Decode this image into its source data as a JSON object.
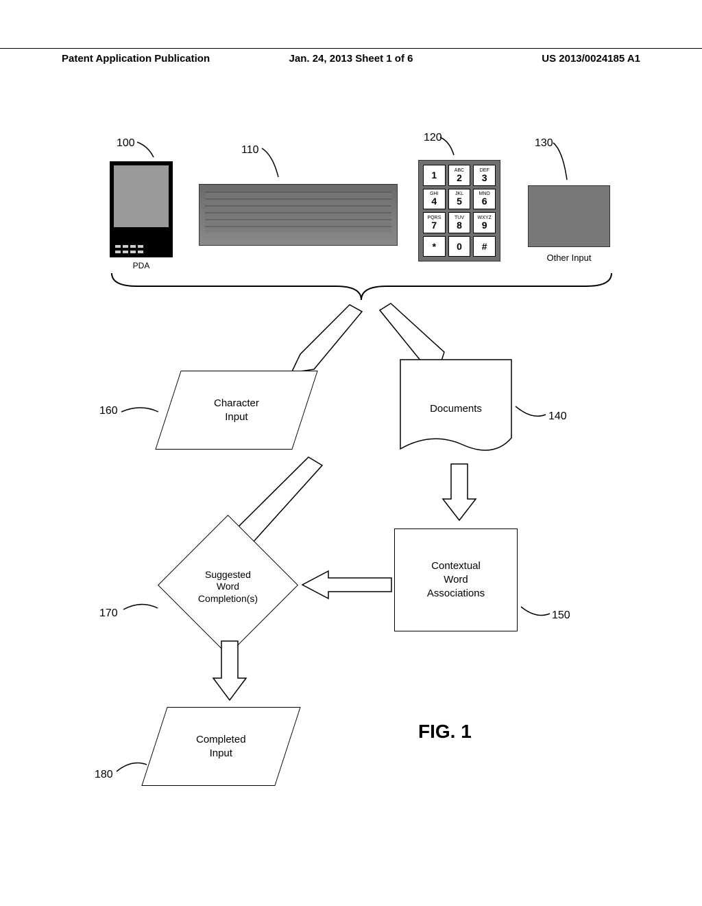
{
  "header": {
    "left": "Patent Application Publication",
    "center": "Jan. 24, 2013  Sheet 1 of 6",
    "right": "US 2013/0024185 A1"
  },
  "refs": {
    "r100": "100",
    "r110": "110",
    "r120": "120",
    "r130": "130",
    "r140": "140",
    "r150": "150",
    "r160": "160",
    "r170": "170",
    "r180": "180"
  },
  "devices": {
    "pda_label": "PDA",
    "other_label": "Other Input",
    "keypad": [
      {
        "sup": "",
        "d": "1"
      },
      {
        "sup": "ABC",
        "d": "2"
      },
      {
        "sup": "DEF",
        "d": "3"
      },
      {
        "sup": "GHI",
        "d": "4"
      },
      {
        "sup": "JKL",
        "d": "5"
      },
      {
        "sup": "MNO",
        "d": "6"
      },
      {
        "sup": "PQRS",
        "d": "7"
      },
      {
        "sup": "TUV",
        "d": "8"
      },
      {
        "sup": "WXYZ",
        "d": "9"
      },
      {
        "sup": "",
        "d": "*"
      },
      {
        "sup": "",
        "d": "0"
      },
      {
        "sup": "",
        "d": "#"
      }
    ]
  },
  "nodes": {
    "char_input": "Character\nInput",
    "documents": "Documents",
    "contextual": "Contextual\nWord\nAssociations",
    "suggested": "Suggested\nWord\nCompletion(s)",
    "completed": "Completed\nInput"
  },
  "figure_label": "FIG. 1"
}
